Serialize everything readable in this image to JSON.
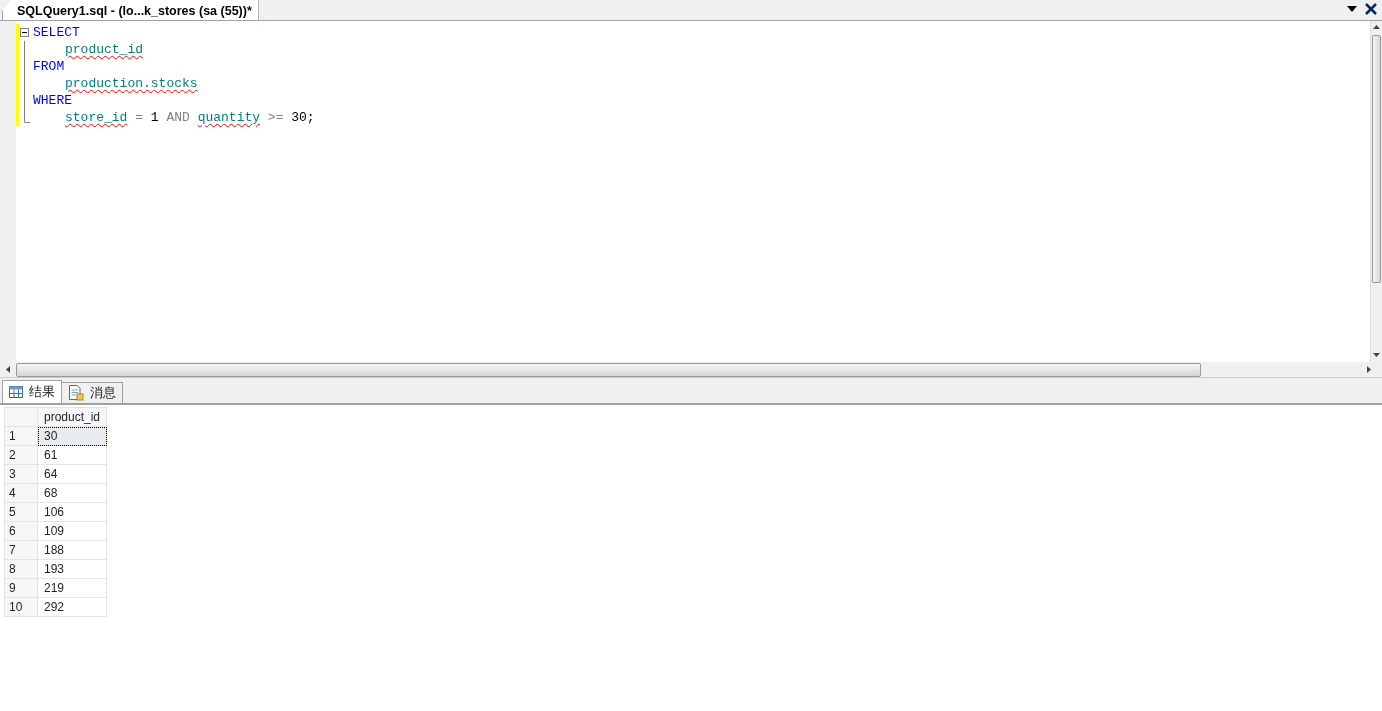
{
  "document_tab": {
    "title": "SQLQuery1.sql - (lo...k_stores (sa (55))*",
    "selected": true
  },
  "editor": {
    "lines": [
      {
        "indent": false,
        "collapsible": true,
        "tokens": [
          {
            "text": "SELECT",
            "kind": "keyword",
            "flagged": false
          }
        ]
      },
      {
        "indent": true,
        "collapsible": false,
        "tokens": [
          {
            "text": "product_id",
            "kind": "identifier",
            "flagged": true
          }
        ]
      },
      {
        "indent": false,
        "collapsible": false,
        "tokens": [
          {
            "text": "FROM",
            "kind": "keyword",
            "flagged": false
          }
        ]
      },
      {
        "indent": true,
        "collapsible": false,
        "tokens": [
          {
            "text": "production.stocks",
            "kind": "identifier",
            "flagged": true
          }
        ]
      },
      {
        "indent": false,
        "collapsible": false,
        "tokens": [
          {
            "text": "WHERE",
            "kind": "keyword",
            "flagged": false
          }
        ]
      },
      {
        "indent": true,
        "collapsible": false,
        "tokens": [
          {
            "text": "store_id",
            "kind": "identifier",
            "flagged": true
          },
          {
            "text": "=",
            "kind": "operator",
            "flagged": false
          },
          {
            "text": "1",
            "kind": "number",
            "flagged": false
          },
          {
            "text": "AND",
            "kind": "operator",
            "flagged": false
          },
          {
            "text": "quantity",
            "kind": "identifier",
            "flagged": true
          },
          {
            "text": ">=",
            "kind": "operator",
            "flagged": false
          },
          {
            "text": "30;",
            "kind": "number",
            "flagged": false
          }
        ]
      }
    ]
  },
  "result_tabs": [
    {
      "label": "结果",
      "selected": true
    },
    {
      "label": "消息",
      "selected": false
    }
  ],
  "results": {
    "columns": [
      "product_id"
    ],
    "rows": [
      {
        "number": "1",
        "cells": [
          "30"
        ],
        "selected": true
      },
      {
        "number": "2",
        "cells": [
          "61"
        ],
        "selected": false
      },
      {
        "number": "3",
        "cells": [
          "64"
        ],
        "selected": false
      },
      {
        "number": "4",
        "cells": [
          "68"
        ],
        "selected": false
      },
      {
        "number": "5",
        "cells": [
          "106"
        ],
        "selected": false
      },
      {
        "number": "6",
        "cells": [
          "109"
        ],
        "selected": false
      },
      {
        "number": "7",
        "cells": [
          "188"
        ],
        "selected": false
      },
      {
        "number": "8",
        "cells": [
          "193"
        ],
        "selected": false
      },
      {
        "number": "9",
        "cells": [
          "219"
        ],
        "selected": false
      },
      {
        "number": "10",
        "cells": [
          "292"
        ],
        "selected": false
      }
    ]
  }
}
